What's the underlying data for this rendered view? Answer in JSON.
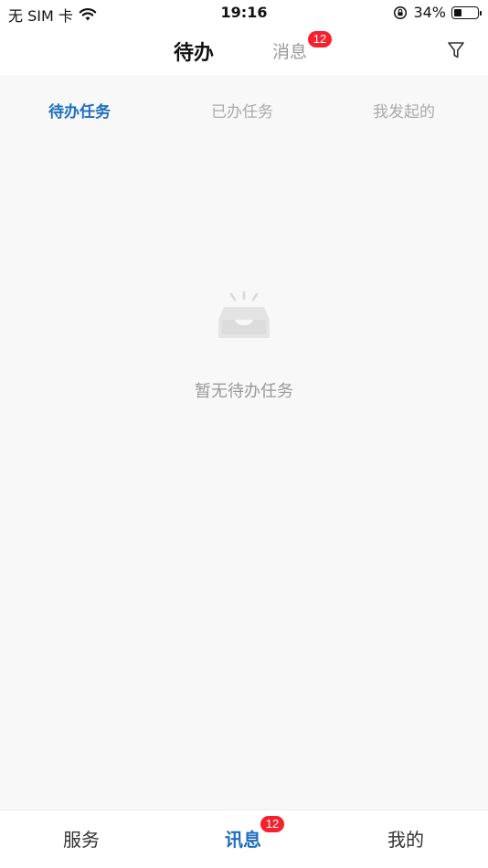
{
  "status_bar": {
    "carrier": "无 SIM 卡",
    "time": "19:16",
    "battery_percent": "34%",
    "battery_level": 0.34
  },
  "header": {
    "tabs": [
      {
        "label": "待办",
        "active": true
      },
      {
        "label": "消息",
        "active": false,
        "badge": "12"
      }
    ]
  },
  "subtabs": [
    {
      "label": "待办任务",
      "active": true
    },
    {
      "label": "已办任务",
      "active": false
    },
    {
      "label": "我发起的",
      "active": false
    }
  ],
  "empty_state": {
    "text": "暂无待办任务",
    "icon": "empty-inbox-icon"
  },
  "bottom_nav": [
    {
      "label": "服务",
      "active": false
    },
    {
      "label": "讯息",
      "active": true,
      "badge": "12"
    },
    {
      "label": "我的",
      "active": false
    }
  ],
  "colors": {
    "accent": "#1e6fbf",
    "badge": "#f5222d",
    "inactive": "#999999",
    "background": "#f8f8f8"
  }
}
